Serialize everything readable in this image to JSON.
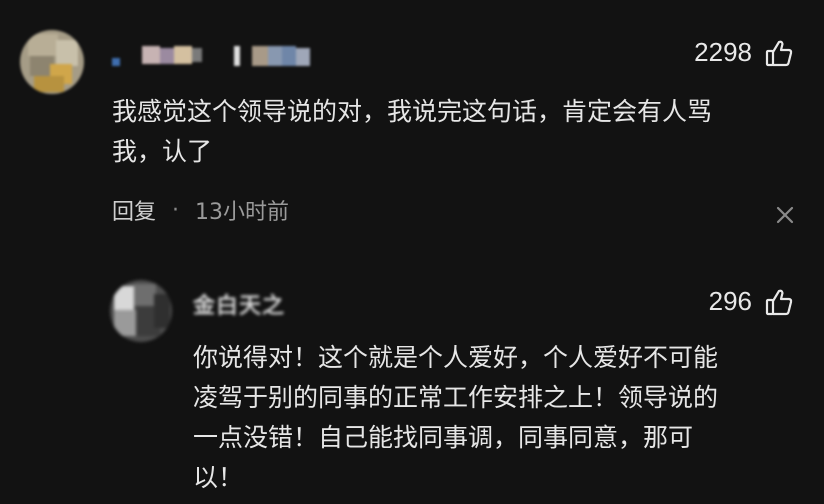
{
  "comment": {
    "username": "",
    "like_count": "2298",
    "text_lines": [
      "我感觉这个领导说的对，我说完这句话，肯定会有人骂",
      "我，认了"
    ],
    "reply_label": "回复",
    "separator": "·",
    "time": "13小时前",
    "icons": {
      "like": "thumbs-up-icon",
      "close": "close-icon"
    }
  },
  "reply": {
    "username": "金白天之",
    "like_count": "296",
    "text_lines": [
      "你说得对！这个就是个人爱好，个人爱好不可能",
      "凌驾于别的同事的正常工作安排之上！领导说的",
      "一点没错！自己能找同事调，同事同意，那可",
      "以！"
    ],
    "icons": {
      "like": "thumbs-up-icon"
    }
  },
  "colors": {
    "background": "#121212",
    "text": "#e6e6e6",
    "muted": "#9a9a9a"
  }
}
